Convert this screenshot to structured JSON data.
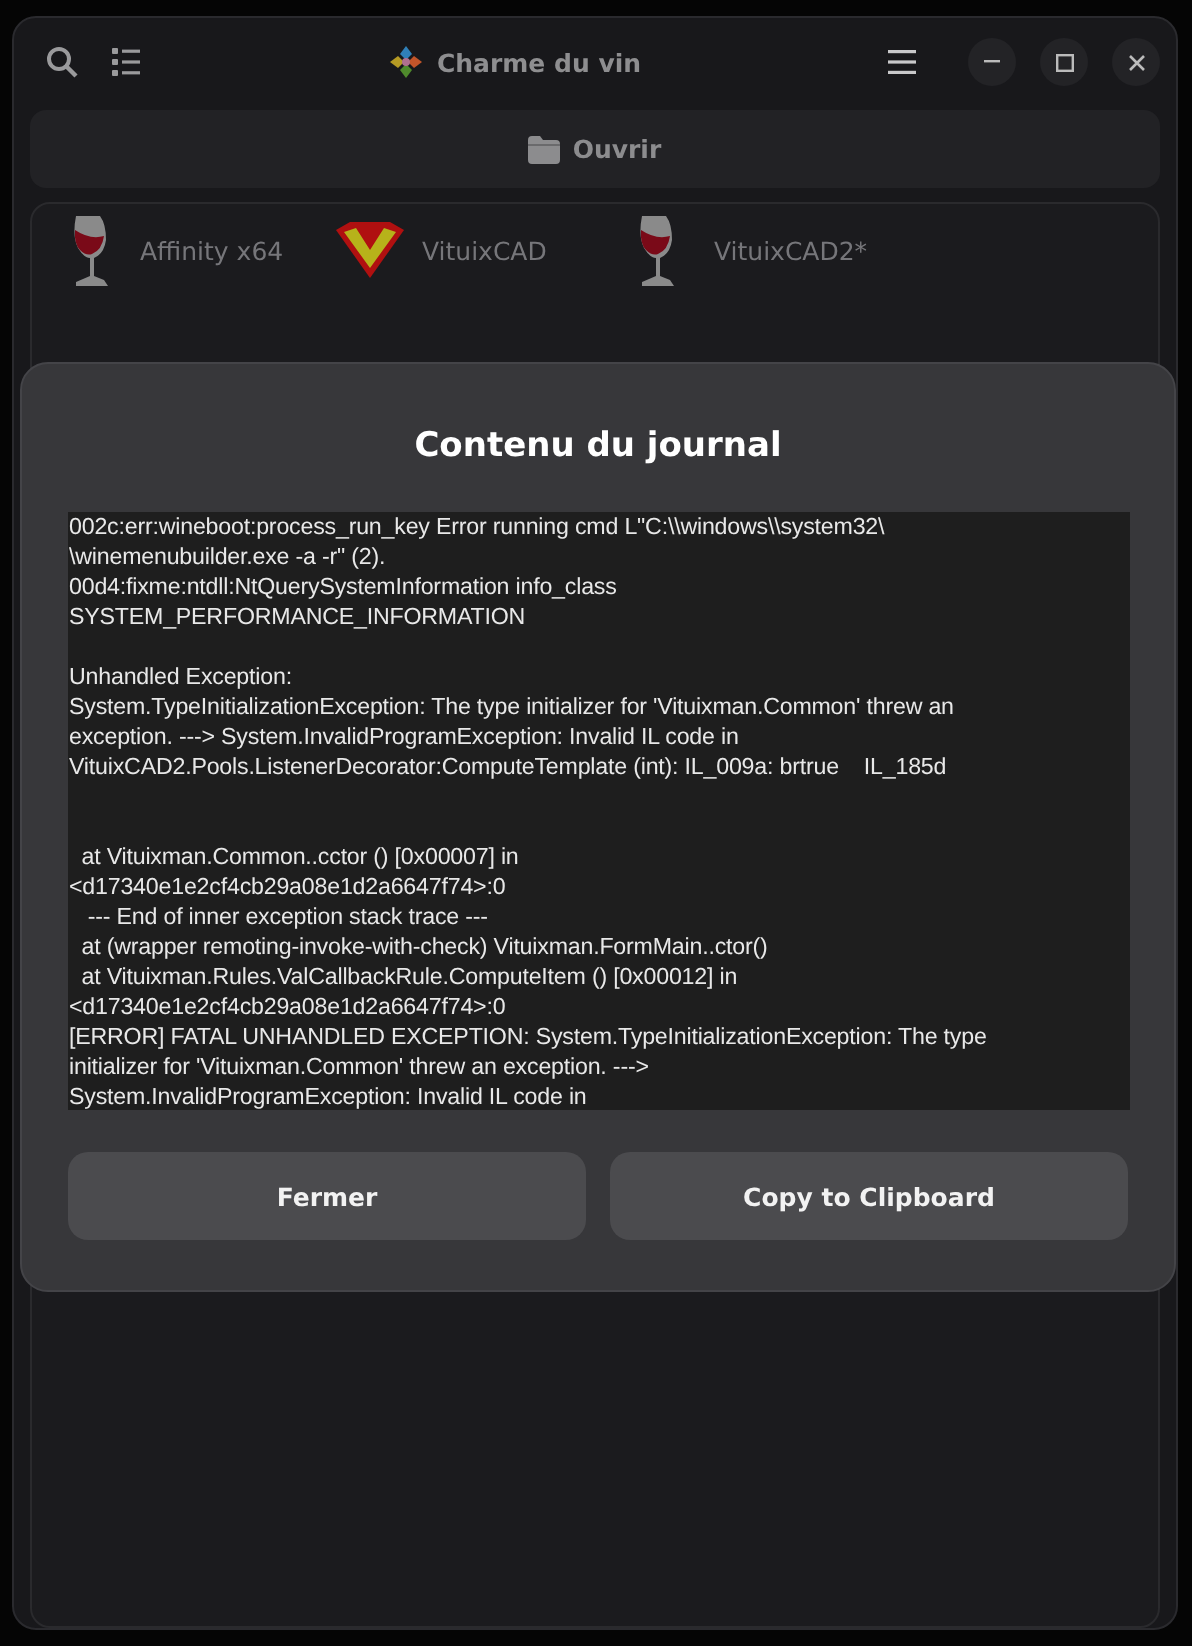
{
  "window": {
    "title": "Charme du vin"
  },
  "toolbar": {
    "open_button": "Ouvrir"
  },
  "apps": [
    {
      "name": "Affinity x64",
      "kind": "wine"
    },
    {
      "name": "VituixCAD",
      "kind": "shield"
    },
    {
      "name": "VituixCAD2*",
      "kind": "wine"
    }
  ],
  "dialog": {
    "title": "Contenu du journal",
    "log": "002c:err:wineboot:process_run_key Error running cmd L\"C:\\\\windows\\\\system32\\\n\\winemenubuilder.exe -a -r\" (2).\n00d4:fixme:ntdll:NtQuerySystemInformation info_class\nSYSTEM_PERFORMANCE_INFORMATION\n\nUnhandled Exception:\nSystem.TypeInitializationException: The type initializer for 'Vituixman.Common' threw an\nexception. ---> System.InvalidProgramException: Invalid IL code in\nVituixCAD2.Pools.ListenerDecorator:ComputeTemplate (int): IL_009a: brtrue    IL_185d\n\n\n  at Vituixman.Common..cctor () [0x00007] in\n<d17340e1e2cf4cb29a08e1d2a6647f74>:0\n   --- End of inner exception stack trace ---\n  at (wrapper remoting-invoke-with-check) Vituixman.FormMain..ctor()\n  at Vituixman.Rules.ValCallbackRule.ComputeItem () [0x00012] in\n<d17340e1e2cf4cb29a08e1d2a6647f74>:0\n[ERROR] FATAL UNHANDLED EXCEPTION: System.TypeInitializationException: The type\ninitializer for 'Vituixman.Common' threw an exception. --->\nSystem.InvalidProgramException: Invalid IL code in",
    "buttons": [
      "Fermer",
      "Copy to Clipboard"
    ]
  }
}
